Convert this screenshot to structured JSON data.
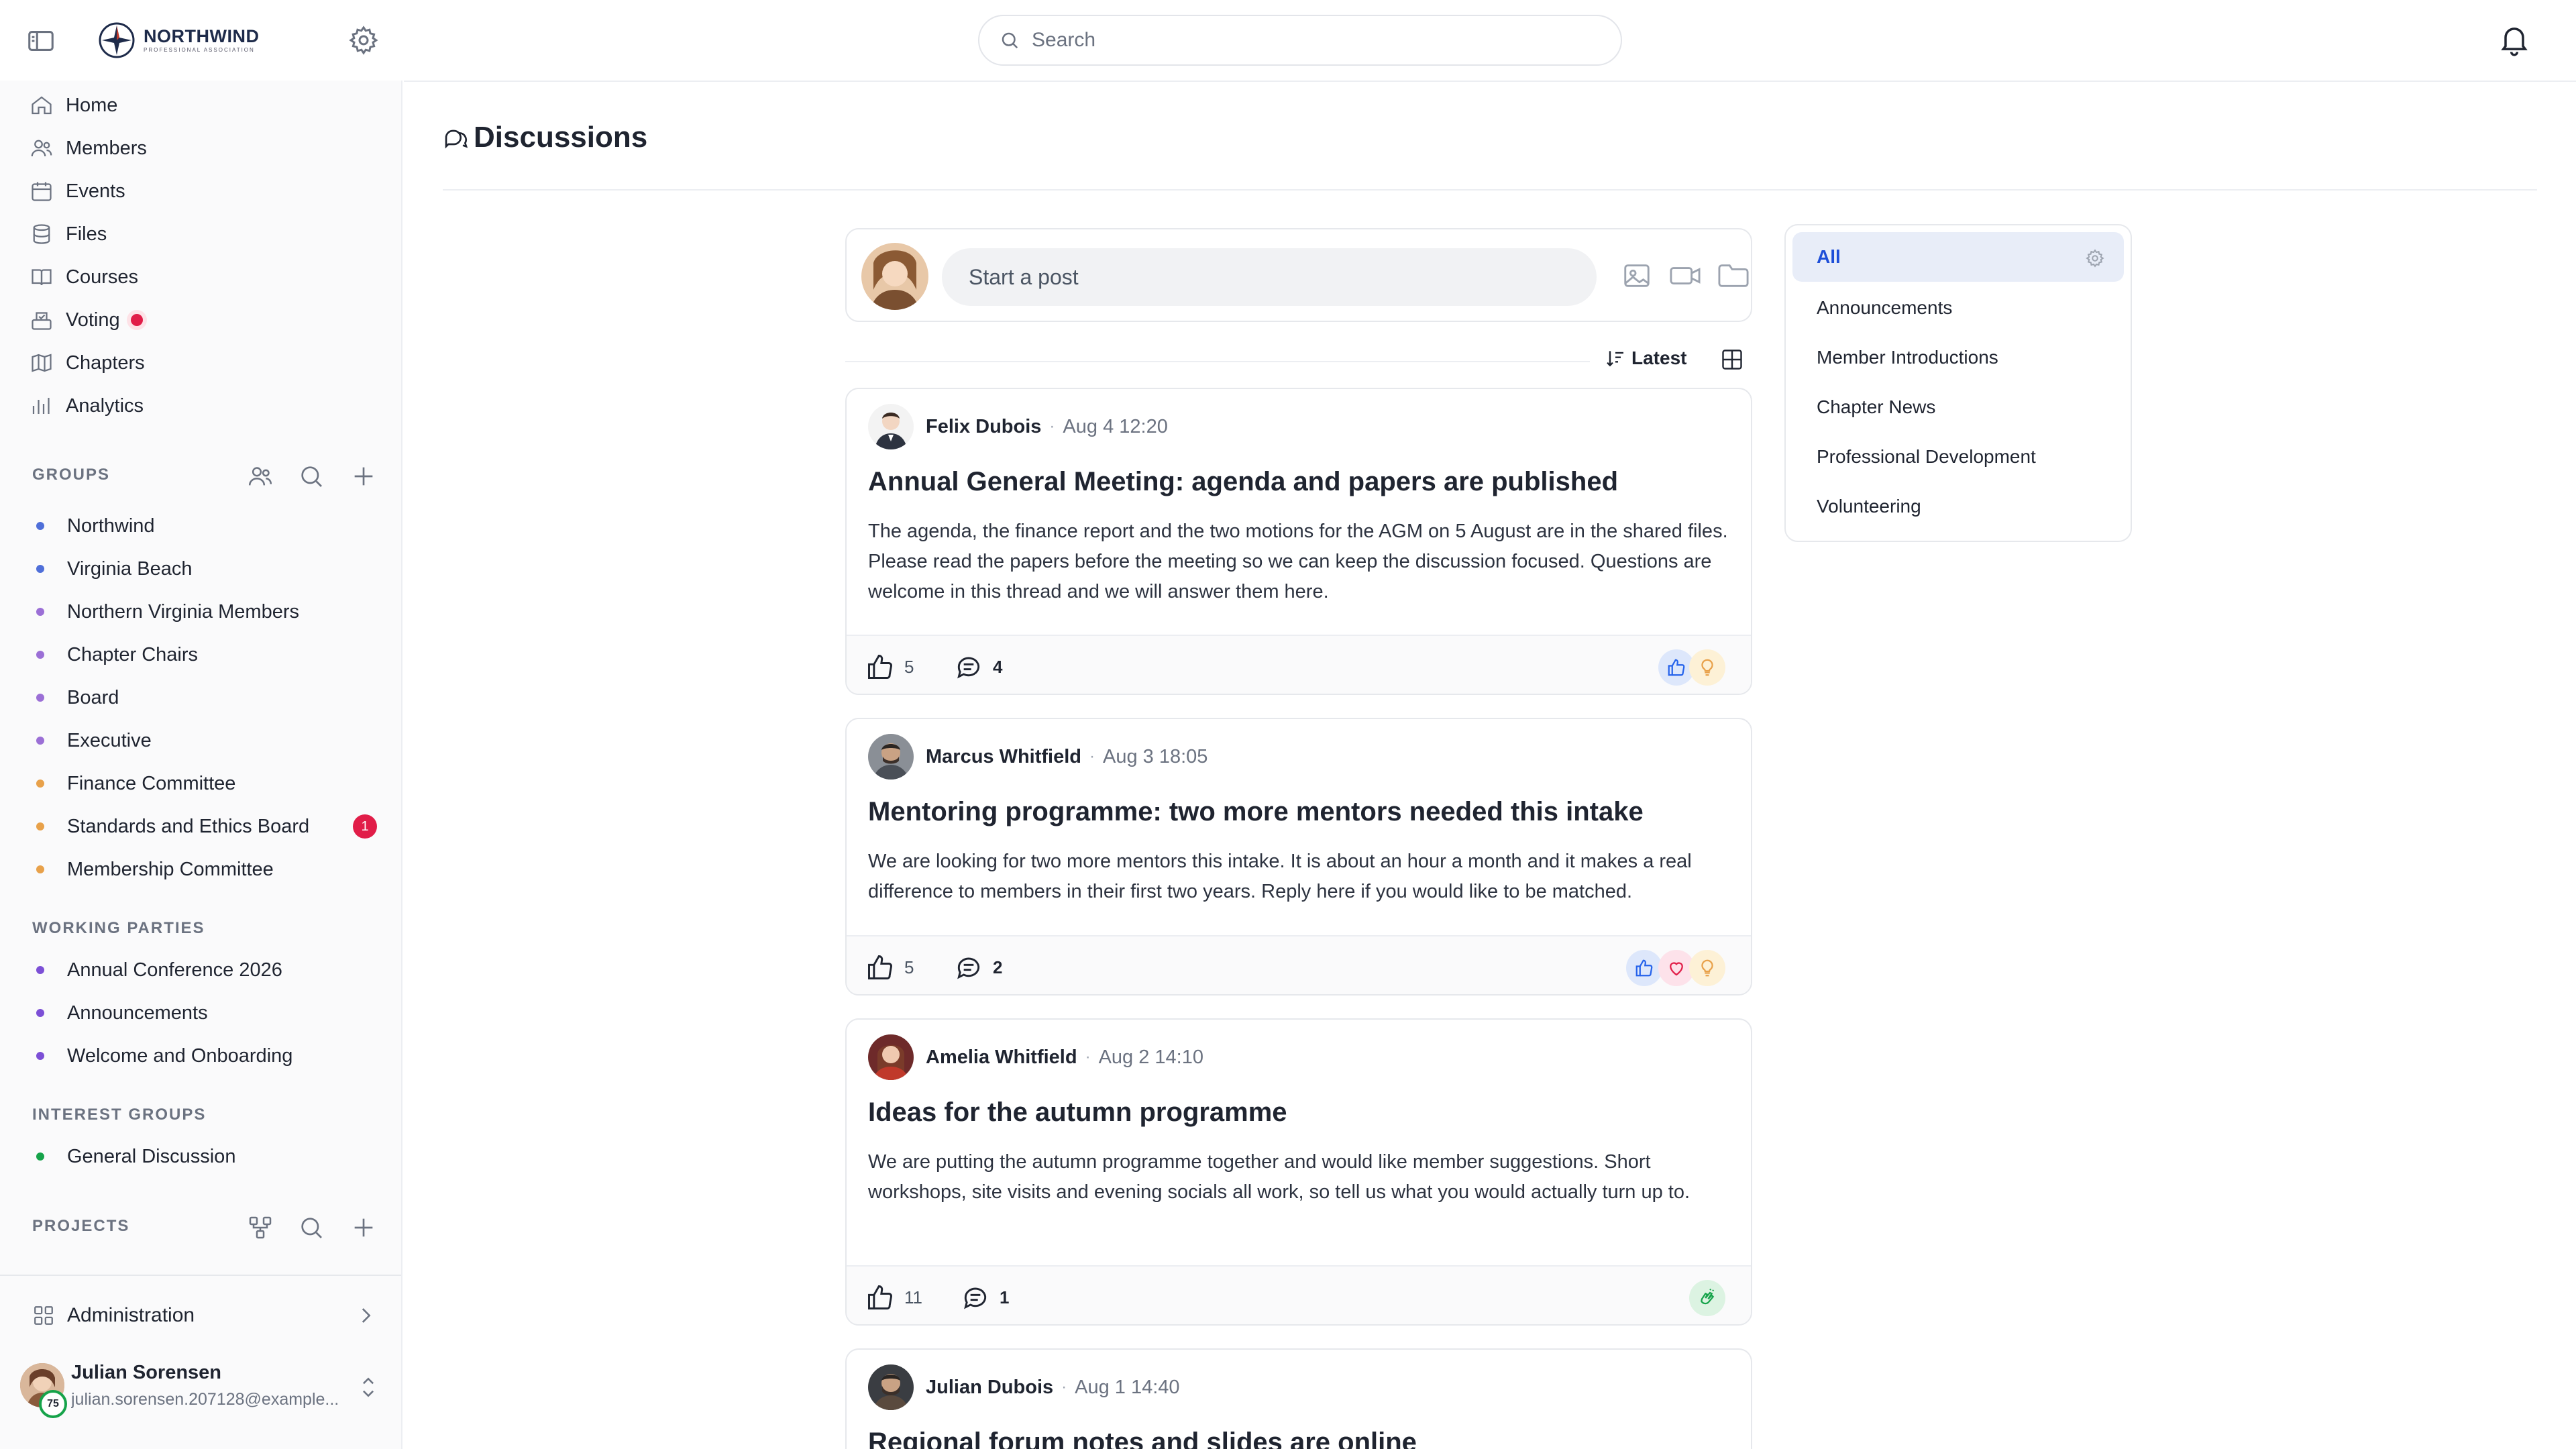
{
  "app": {
    "brand": {
      "title": "NORTHWIND",
      "subtitle": "PROFESSIONAL ASSOCIATION"
    },
    "search": {
      "placeholder": "Search"
    }
  },
  "sidebar": {
    "nav": [
      {
        "label": "Home",
        "icon": "home-icon"
      },
      {
        "label": "Members",
        "icon": "members-icon"
      },
      {
        "label": "Events",
        "icon": "calendar-icon"
      },
      {
        "label": "Files",
        "icon": "database-icon"
      },
      {
        "label": "Courses",
        "icon": "book-icon"
      },
      {
        "label": "Voting",
        "icon": "ballot-icon"
      },
      {
        "label": "Chapters",
        "icon": "map-icon"
      },
      {
        "label": "Analytics",
        "icon": "chart-icon"
      }
    ],
    "groups_heading": "GROUPS",
    "groups": [
      {
        "label": "Northwind",
        "color": "#4f6fd9"
      },
      {
        "label": "Virginia Beach",
        "color": "#4f6fd9"
      },
      {
        "label": "Northern Virginia Members",
        "color": "#9b6fd6"
      },
      {
        "label": "Chapter Chairs",
        "color": "#9b6fd6"
      },
      {
        "label": "Board",
        "color": "#9b6fd6"
      },
      {
        "label": "Executive",
        "color": "#9b6fd6"
      },
      {
        "label": "Finance Committee",
        "color": "#e8a14a"
      },
      {
        "label": "Standards and Ethics Board",
        "color": "#e8a14a",
        "badge": "1"
      },
      {
        "label": "Membership Committee",
        "color": "#e8a14a"
      }
    ],
    "working_heading": "WORKING PARTIES",
    "working": [
      {
        "label": "Annual Conference 2026",
        "color": "#7c4fd6"
      },
      {
        "label": "Announcements",
        "color": "#7c4fd6"
      },
      {
        "label": "Welcome and Onboarding",
        "color": "#7c4fd6"
      }
    ],
    "interest_heading": "INTEREST GROUPS",
    "interest": [
      {
        "label": "General Discussion",
        "color": "#16a34a"
      }
    ],
    "projects_heading": "PROJECTS",
    "admin_label": "Administration",
    "user": {
      "name": "Julian Sorensen",
      "email": "julian.sorensen.207128@example....",
      "progress_badge": "75"
    }
  },
  "main": {
    "title": "Discussions",
    "composer_placeholder": "Start a post",
    "sort_label": "Latest",
    "posts": [
      {
        "author": "Felix Dubois",
        "time": "Aug 4 12:20",
        "title": "Annual General Meeting: agenda and papers are published",
        "body": "The agenda, the finance report and the two motions for the AGM on 5 August are in the shared files. Please read the papers before the meeting so we can keep the discussion focused. Questions are welcome in this thread and we will answer them here.",
        "likes": "5",
        "comments": "4"
      },
      {
        "author": "Marcus Whitfield",
        "time": "Aug 3 18:05",
        "title": "Mentoring programme: two more mentors needed this intake",
        "body": "We are looking for two more mentors this intake. It is about an hour a month and it makes a real difference to members in their first two years. Reply here if you would like to be matched.",
        "likes": "5",
        "comments": "2"
      },
      {
        "author": "Amelia Whitfield",
        "time": "Aug 2 14:10",
        "title": "Ideas for the autumn programme",
        "body": "We are putting the autumn programme together and would like member suggestions. Short workshops, site visits and evening socials all work, so tell us what you would actually turn up to.",
        "likes": "11",
        "comments": "1"
      },
      {
        "author": "Julian Dubois",
        "time": "Aug 1 14:40",
        "title": "Regional forum notes and slides are online"
      }
    ]
  },
  "topics": {
    "items": [
      "All",
      "Announcements",
      "Member Introductions",
      "Chapter News",
      "Professional Development",
      "Volunteering"
    ],
    "active": "All"
  }
}
